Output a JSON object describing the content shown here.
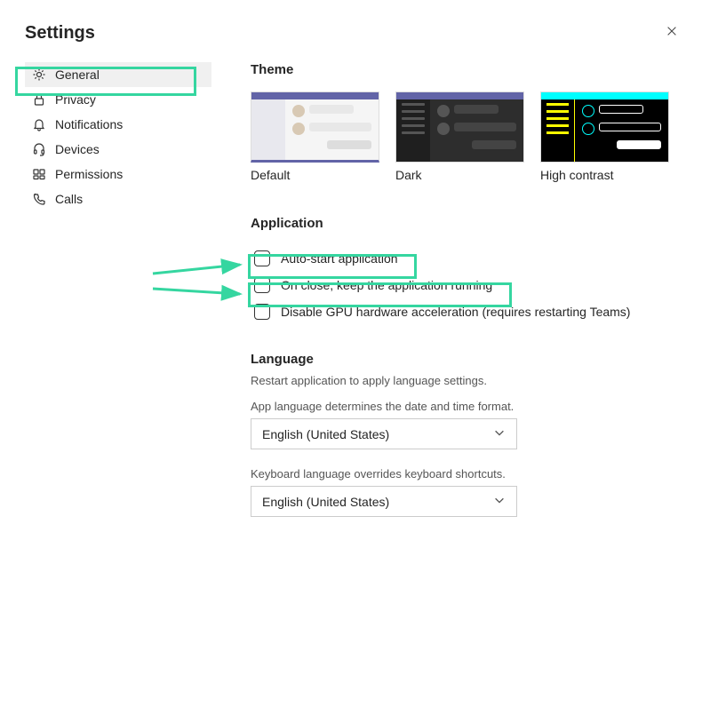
{
  "page_title": "Settings",
  "sidebar": {
    "items": [
      {
        "label": "General",
        "icon": "gear",
        "active": true
      },
      {
        "label": "Privacy",
        "icon": "lock",
        "active": false
      },
      {
        "label": "Notifications",
        "icon": "bell",
        "active": false
      },
      {
        "label": "Devices",
        "icon": "headset",
        "active": false
      },
      {
        "label": "Permissions",
        "icon": "permissions",
        "active": false
      },
      {
        "label": "Calls",
        "icon": "phone",
        "active": false
      }
    ]
  },
  "theme": {
    "title": "Theme",
    "options": [
      {
        "label": "Default",
        "selected": true
      },
      {
        "label": "Dark",
        "selected": false
      },
      {
        "label": "High contrast",
        "selected": false
      }
    ]
  },
  "application": {
    "title": "Application",
    "items": [
      {
        "label": "Auto-start application",
        "checked": false,
        "highlighted": true
      },
      {
        "label": "On close, keep the application running",
        "checked": false,
        "highlighted": true
      },
      {
        "label": "Disable GPU hardware acceleration (requires restarting Teams)",
        "checked": false,
        "highlighted": false
      }
    ]
  },
  "language": {
    "title": "Language",
    "restart_note": "Restart application to apply language settings.",
    "app_lang_note": "App language determines the date and time format.",
    "app_lang_value": "English (United States)",
    "keyboard_note": "Keyboard language overrides keyboard shortcuts.",
    "keyboard_value": "English (United States)"
  },
  "annotations": {
    "highlight_color": "#35d6a0"
  }
}
